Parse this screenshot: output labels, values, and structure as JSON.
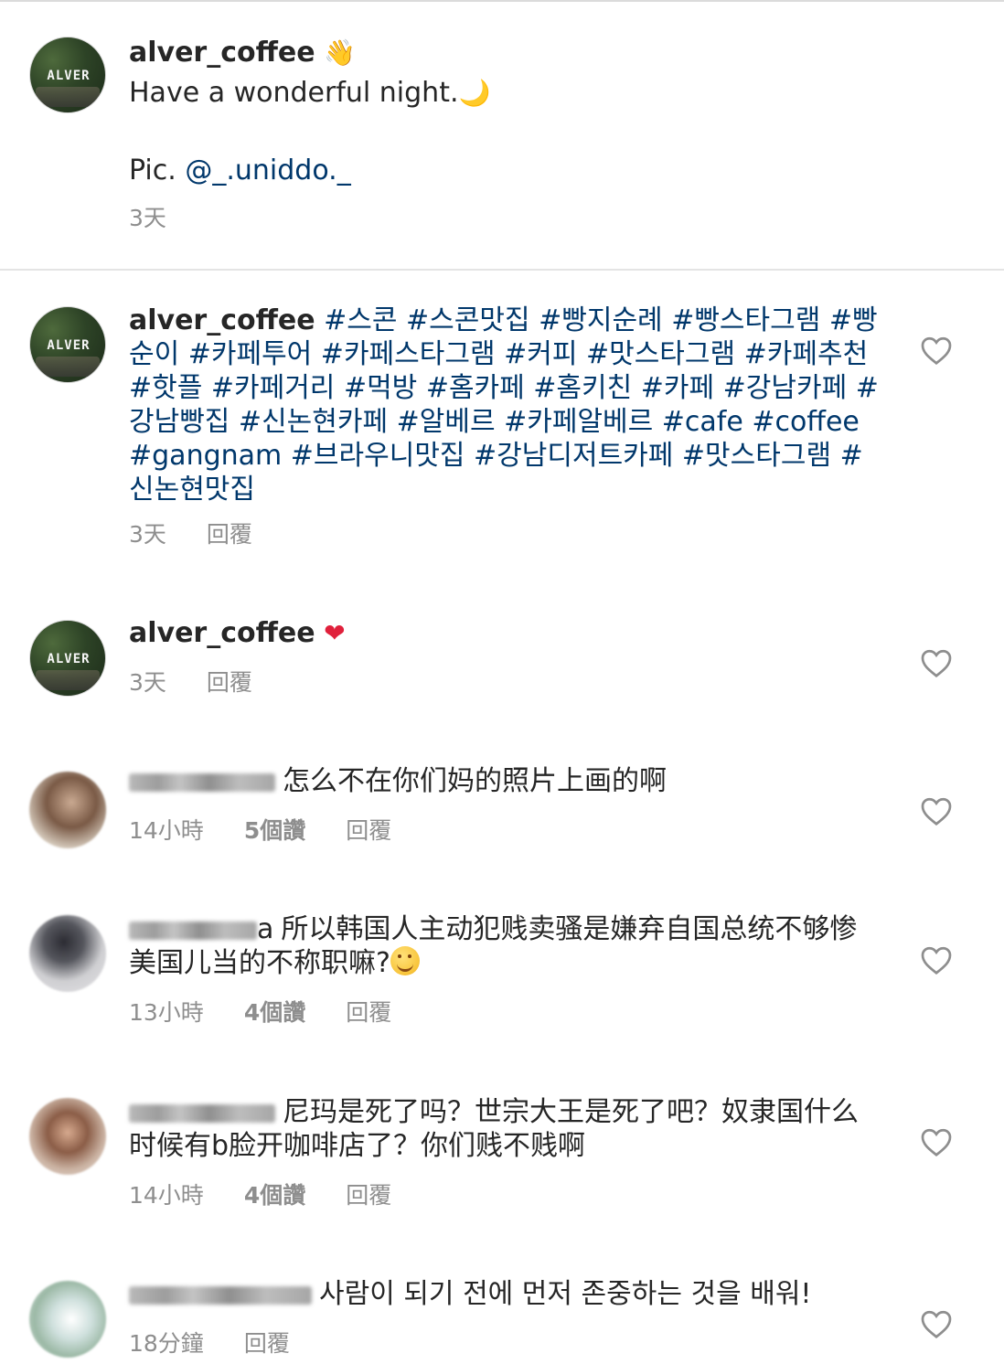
{
  "caption": {
    "username": "alver_coffee",
    "emoji": "👋",
    "line1": "Have a wonderful night.",
    "line1_emoji": "🌙",
    "pic_prefix": "Pic. ",
    "mention": "@_.uniddo._",
    "time": "3天"
  },
  "comments": [
    {
      "username": "alver_coffee",
      "hashtags": "#스콘 #스콘맛집 #빵지순례 #빵스타그램 #빵순이 #카페투어 #카페스타그램 #커피 #맛스타그램 #카페추천 #핫플 #카페거리 #먹방 #홈카페 #홈키친 #카페 #강남카페 #강남빵집 #신논현카페 #알베르 #카페알베르 #cafe #coffee #gangnam #브라우니맛집 #강남디저트카페 #맛스타그램 #신논현맛집",
      "time": "3天",
      "reply": "回覆"
    },
    {
      "username": "alver_coffee",
      "emoji": "❤",
      "time": "3天",
      "reply": "回覆"
    },
    {
      "text": "怎么不在你们妈的照片上画的啊",
      "time": "14小時",
      "likes": "5個讚",
      "reply": "回覆"
    },
    {
      "text_lead": "a",
      "text": "所以韩国人主动犯贱卖骚是嫌弃自国总统不够惨美国儿当的不称职嘛?",
      "time": "13小時",
      "likes": "4個讚",
      "reply": "回覆"
    },
    {
      "text": "尼玛是死了吗？世宗大王是死了吧？奴隶国什么时候有b脸开咖啡店了？你们贱不贱啊",
      "time": "14小時",
      "likes": "4個讚",
      "reply": "回覆"
    },
    {
      "text": "사람이 되기 전에 먼저 존중하는 것을 배워!",
      "time": "18分鐘",
      "reply": "回覆"
    }
  ],
  "avatar_logo": "ALVER"
}
